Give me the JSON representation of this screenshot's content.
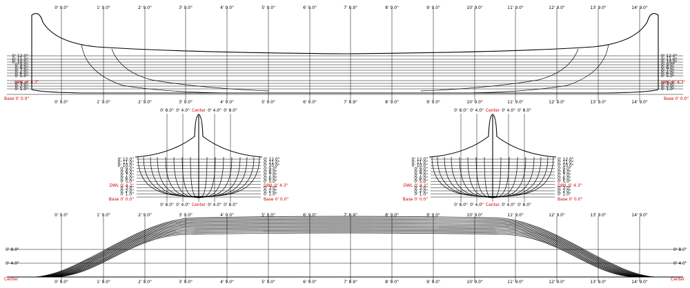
{
  "stations": [
    "0' 9.0\"",
    "1' 9.0\"",
    "2' 9.0\"",
    "3' 9.0\"",
    "4' 9.0\"",
    "5' 9.0\"",
    "6' 9.0\"",
    "7' 8.9\"",
    "8' 9.0\"",
    "9' 9.0\"",
    "10' 9.0\"",
    "11' 9.0\"",
    "12' 9.0\"",
    "13' 9.0\"",
    "14' 9.0\""
  ],
  "profile": {
    "waterlines": [
      "0' 12.0\"",
      "0' 11.0\"",
      "0' 10.0\"",
      "0' 9.0\"",
      "0' 8.0\"",
      "0' 7.0\"",
      "0' 6.0\"",
      "0' 5.0\"",
      "0' 4.3\"",
      "0' 3.0\"",
      "0' 2.0\"",
      "0' 1.0\""
    ],
    "dwl_label": "DWL 0' 4.3\"",
    "base_label": "Base 0' 0.0\""
  },
  "body_plan_left": {
    "top_labels": [
      "0' 8.0\"",
      "0' 4.0\"",
      "Center",
      "0' 4.0\"",
      "0' 8.0\""
    ],
    "bottom_labels": [
      "0' 8.0\"",
      "0' 4.0\"",
      "Center",
      "0' 4.0\"",
      "0' 8.0\""
    ],
    "left_waterlines": [
      "0' 12.0\"",
      "0' 11.0\"",
      "0' 10.0\"",
      "0' 9.0\"",
      "0' 8.0\"",
      "0' 7.0\"",
      "0' 6.0\"",
      "0' 5.0\"",
      "0' 4.0\"",
      "0' 3.0\"",
      "0' 2.0\"",
      "0' 1.0\""
    ],
    "right_waterlines": [
      "0' 12.0\"",
      "0' 11.0\"",
      "0' 10.0\"",
      "0' 9.0\"",
      "0' 8.0\"",
      "0' 7.0\"",
      "0' 6.0\"",
      "0' 5.0\"",
      "0' 4.0\"",
      "0' 3.0\"",
      "0' 2.0\"",
      "0' 1.0\""
    ],
    "dwl_label": "DWL 0' 4.3\"",
    "base_label": "Base 0' 0.0\""
  },
  "body_plan_right": {
    "top_labels": [
      "0' 8.0\"",
      "0' 4.0\"",
      "Center",
      "0' 4.0\"",
      "0' 8.0\""
    ],
    "bottom_labels": [
      "0' 8.0\"",
      "0' 4.0\"",
      "Center",
      "0' 4.0\"",
      "0' 8.0\""
    ],
    "left_waterlines": [
      "0' 12.0\"",
      "0' 11.0\"",
      "0' 10.0\"",
      "0' 9.0\"",
      "0' 8.0\"",
      "0' 7.0\"",
      "0' 6.0\"",
      "0' 5.0\"",
      "0' 4.0\"",
      "0' 3.0\"",
      "0' 2.0\"",
      "0' 1.0\""
    ],
    "right_waterlines": [
      "0' 12.0\"",
      "0' 11.0\"",
      "0' 10.0\"",
      "0' 9.0\"",
      "0' 8.0\"",
      "0' 7.0\"",
      "0' 6.0\"",
      "0' 5.0\"",
      "0' 4.0\"",
      "0' 3.0\"",
      "0' 2.0\"",
      "0' 1.0\""
    ],
    "dwl_label": "DWL 0' 4.3\"",
    "base_label": "Base 0' 0.0\""
  },
  "plan_view": {
    "offsets": [
      "0' 8.0\"",
      "0' 4.0\""
    ],
    "center_label": "Center"
  },
  "colors": {
    "line": "#000000",
    "reference_label": "#d40000",
    "background": "#ffffff"
  }
}
